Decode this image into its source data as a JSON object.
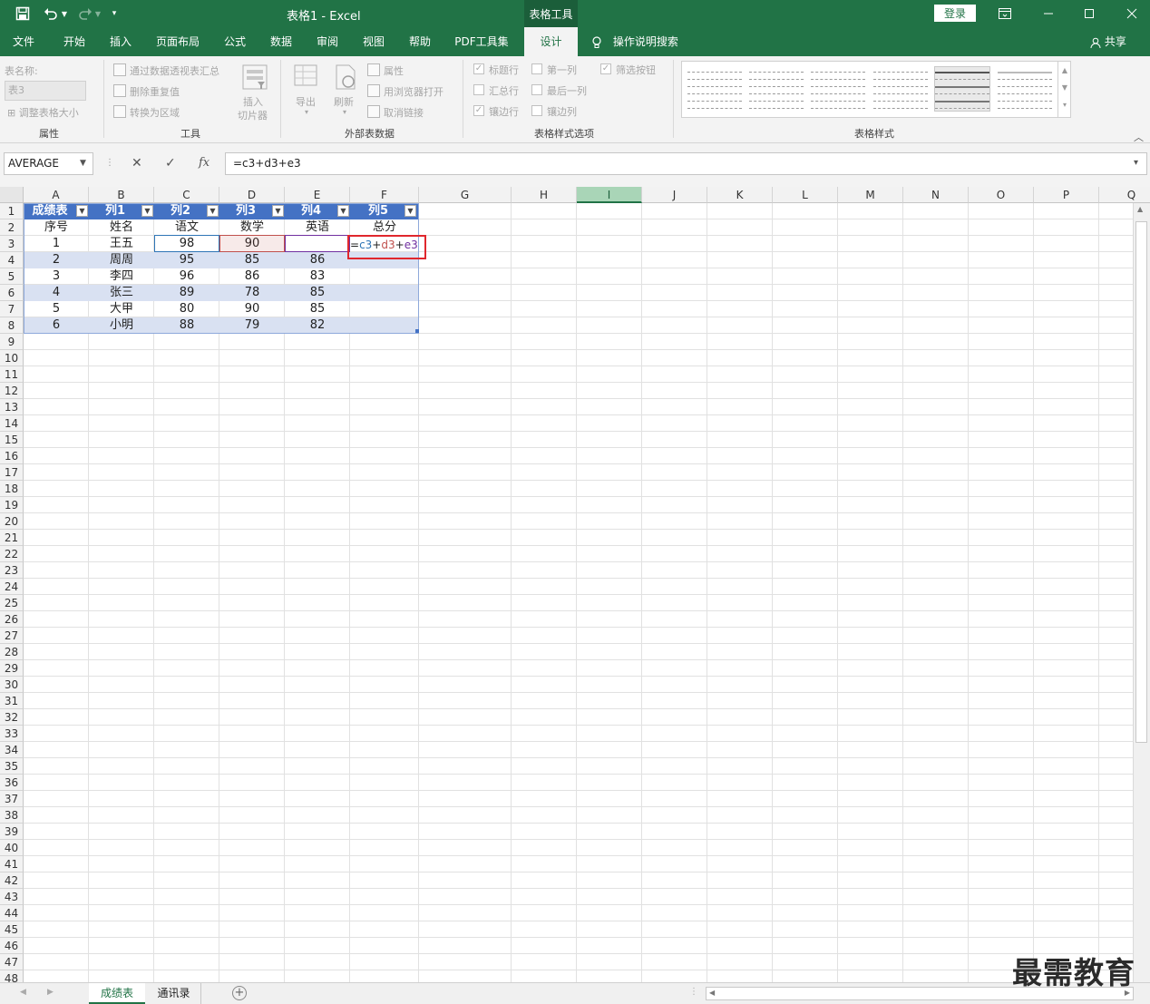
{
  "titlebar": {
    "title": "表格1  -  Excel",
    "context_tab": "表格工具",
    "login": "登录"
  },
  "menu": {
    "tabs": [
      "文件",
      "开始",
      "插入",
      "页面布局",
      "公式",
      "数据",
      "审阅",
      "视图",
      "帮助",
      "PDF工具集",
      "设计"
    ],
    "active_tab": "设计",
    "tellme": "操作说明搜索",
    "share": "共享"
  },
  "ribbon": {
    "properties": {
      "name_label": "表名称:",
      "table_name": "表3",
      "resize": "调整表格大小",
      "group_label": "属性"
    },
    "tools": {
      "pivot": "通过数据透视表汇总",
      "remove_dup": "删除重复值",
      "convert": "转换为区域",
      "slicer_line1": "插入",
      "slicer_line2": "切片器",
      "group_label": "工具"
    },
    "external": {
      "export": "导出",
      "refresh": "刷新",
      "properties": "属性",
      "open_browser": "用浏览器打开",
      "unlink": "取消链接",
      "group_label": "外部表数据"
    },
    "style_options": {
      "header_row": "标题行",
      "first_col": "第一列",
      "filter_btn": "筛选按钮",
      "total_row": "汇总行",
      "last_col": "最后一列",
      "banded_rows": "镶边行",
      "banded_cols": "镶边列",
      "group_label": "表格样式选项"
    },
    "styles": {
      "group_label": "表格样式"
    }
  },
  "formula_bar": {
    "name_box": "AVERAGE",
    "cancel_icon": "✕",
    "enter_icon": "✓",
    "fx_label": "fx",
    "formula": "=c3+d3+e3"
  },
  "grid": {
    "columns": [
      "A",
      "B",
      "C",
      "D",
      "E",
      "F",
      "G",
      "H",
      "I",
      "J",
      "K",
      "L",
      "M",
      "N",
      "O",
      "P",
      "Q"
    ],
    "active_column": "I",
    "row_count": 48,
    "table_headers": [
      "成绩表",
      "列1",
      "列2",
      "列3",
      "列4",
      "列5"
    ],
    "rows": [
      [
        "序号",
        "姓名",
        "语文",
        "数学",
        "英语",
        "总分"
      ],
      [
        "1",
        "王五",
        "98",
        "90",
        "",
        ""
      ],
      [
        "2",
        "周周",
        "95",
        "85",
        "86",
        ""
      ],
      [
        "3",
        "李四",
        "96",
        "86",
        "83",
        ""
      ],
      [
        "4",
        "张三",
        "89",
        "78",
        "85",
        ""
      ],
      [
        "5",
        "大甲",
        "80",
        "90",
        "85",
        ""
      ],
      [
        "6",
        "小明",
        "88",
        "79",
        "82",
        ""
      ]
    ],
    "active_cell_formula": {
      "eq": "=",
      "ref1": "c3",
      "plus1": "+",
      "ref2": "d3",
      "plus2": "+",
      "ref3": "e3"
    },
    "ref_colors": {
      "c3": "#2e75b6",
      "d3": "#c0504d",
      "e3": "#7030a0"
    }
  },
  "sheets": {
    "tabs": [
      "成绩表",
      "通讯录"
    ],
    "active": "成绩表"
  },
  "watermark": "最需教育"
}
